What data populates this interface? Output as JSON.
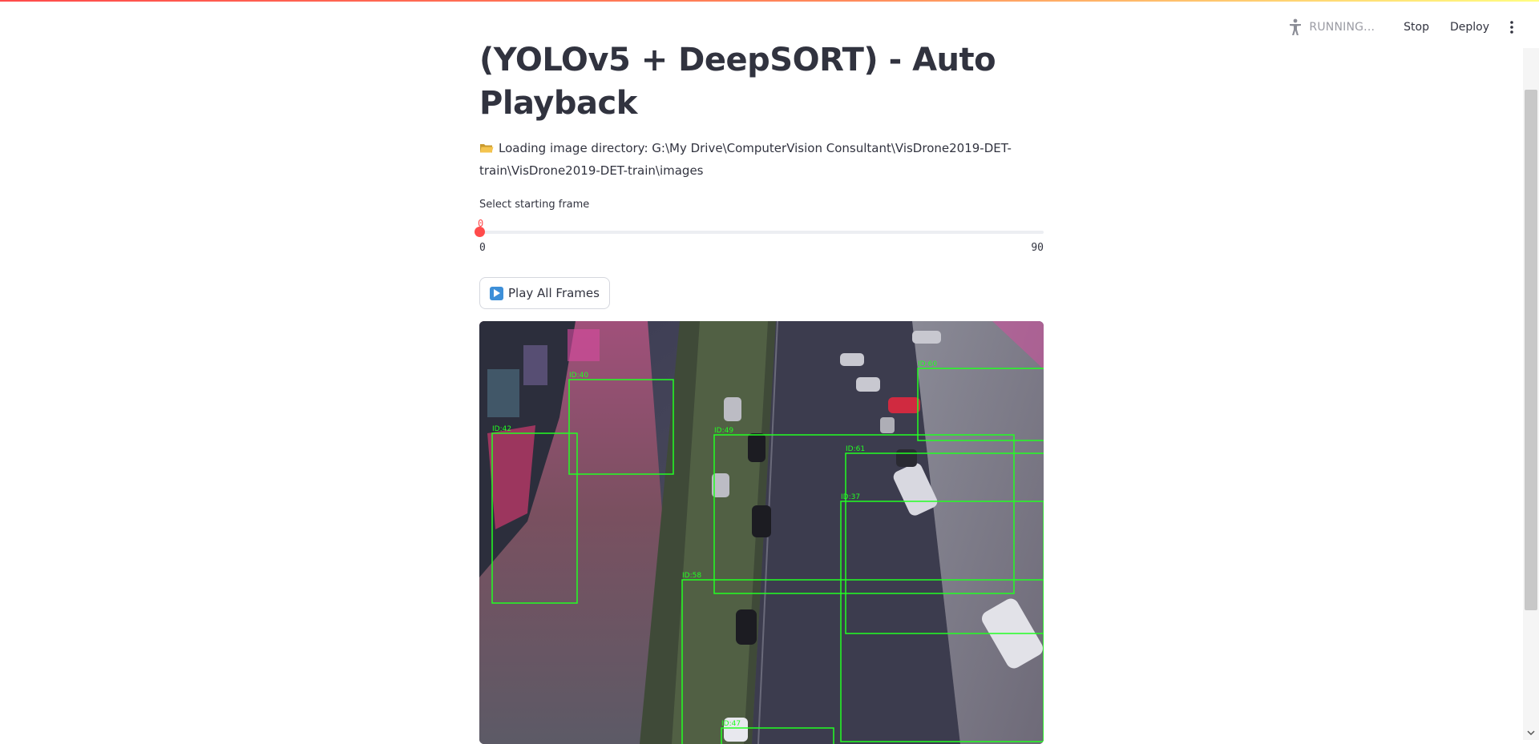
{
  "header": {
    "status_label": "RUNNING...",
    "stop_label": "Stop",
    "deploy_label": "Deploy",
    "running_icon": "running-person-icon",
    "menu_icon": "vertical-dots-icon"
  },
  "main": {
    "title": "(YOLOv5 + DeepSORT) - Auto Playback",
    "info_icon": "folder-icon",
    "info_text": "Loading image directory: G:\\My Drive\\ComputerVision Consultant\\VisDrone2019-DET-train\\VisDrone2019-DET-train\\images",
    "slider": {
      "label": "Select starting frame",
      "value": "0",
      "min": "0",
      "max": "90",
      "fraction": 0
    },
    "play_button": {
      "icon": "play-button-icon",
      "label": "Play All Frames"
    },
    "frame": {
      "description_icon": "drone-street-frame",
      "detections": [
        {
          "id": "ID:40"
        },
        {
          "id": "ID:42"
        },
        {
          "id": "ID:49"
        },
        {
          "id": "ID:60"
        },
        {
          "id": "ID:61"
        },
        {
          "id": "ID:37"
        },
        {
          "id": "ID:58"
        },
        {
          "id": "ID:47"
        }
      ]
    }
  },
  "colors": {
    "accent": "#ff4b4b",
    "box": "#22ff22",
    "text": "#31333f"
  }
}
